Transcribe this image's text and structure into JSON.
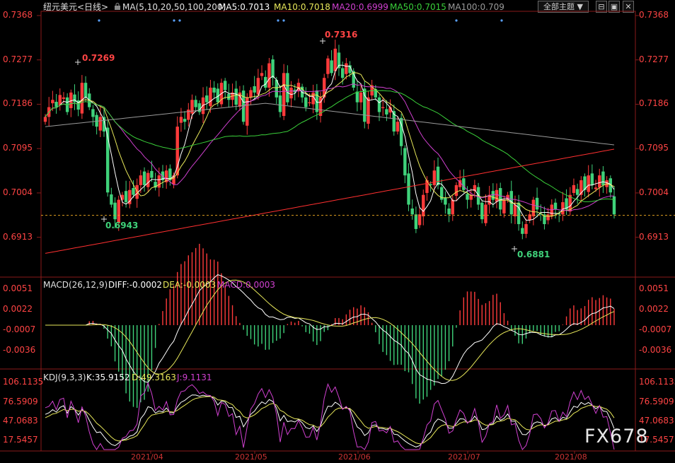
{
  "header": {
    "symbol_label": "纽元美元<日线>",
    "ma_title": "MA(5,10,20,50,100,200)",
    "ma5": "MA5:0.7013",
    "ma10": "MA10:0.7018",
    "ma20": "MA20:0.6999",
    "ma50": "MA50:0.7015",
    "ma100": "MA100:0.709",
    "theme_button": "全部主题",
    "window_icons": [
      "restore-icon",
      "window-icon",
      "close-icon"
    ]
  },
  "price_axis": {
    "ticks": [
      "0.7368",
      "0.7277",
      "0.7186",
      "0.7095",
      "0.7004",
      "0.6913"
    ]
  },
  "annotations": {
    "high1": "0.7269",
    "low1": "0.6943",
    "high2": "0.7316",
    "low2": "0.6881"
  },
  "macd": {
    "title": "MACD(26,12,9)",
    "diff": "DIFF:-0.0002",
    "dea": "DEA:-0.0003",
    "macd": "MACD:0.0003",
    "ticks": [
      "0.0051",
      "0.0022",
      "-0.0007",
      "-0.0036"
    ]
  },
  "kdj": {
    "title": "KDJ(9,3,3)",
    "k": "K:35.9152",
    "d": "D:49.3163",
    "j": "J:9.1131",
    "ticks": [
      "106.1135",
      "76.5909",
      "47.0683",
      "17.5457"
    ]
  },
  "date_axis": [
    "2021/04",
    "2021/05",
    "2021/06",
    "2021/07",
    "2021/08"
  ],
  "watermark": "FX678",
  "colors": {
    "background": "#000000",
    "up": "#ff3b3b",
    "down": "#3fd27a",
    "axis_text": "#ff4444",
    "ma5": "#ffffff",
    "ma10": "#e8e85a",
    "ma20": "#d040d0",
    "ma50": "#3ad03a",
    "ma100": "#9a9a9a",
    "ma200": "#ff3030"
  },
  "chart_data": {
    "type": "candlestick",
    "series_names": [
      "MA5",
      "MA10",
      "MA20",
      "MA50",
      "MA100",
      "MA200"
    ],
    "ylim": [
      0.684,
      0.7368
    ],
    "current_price_line": 0.6958,
    "x_dates": [
      "2021/04",
      "2021/05",
      "2021/06",
      "2021/07",
      "2021/08"
    ],
    "close": [
      0.716,
      0.718,
      0.7195,
      0.718,
      0.7205,
      0.72,
      0.717,
      0.721,
      0.719,
      0.7175,
      0.723,
      0.72,
      0.718,
      0.716,
      0.714,
      0.716,
      0.713,
      0.7005,
      0.698,
      0.695,
      0.699,
      0.7,
      0.6985,
      0.701,
      0.7,
      0.702,
      0.704,
      0.702,
      0.7045,
      0.7035,
      0.7015,
      0.704,
      0.703,
      0.705,
      0.703,
      0.704,
      0.714,
      0.716,
      0.715,
      0.7175,
      0.7195,
      0.718,
      0.717,
      0.72,
      0.719,
      0.722,
      0.721,
      0.719,
      0.723,
      0.7215,
      0.7195,
      0.721,
      0.7185,
      0.721,
      0.715,
      0.72,
      0.7215,
      0.721,
      0.724,
      0.725,
      0.722,
      0.727,
      0.724,
      0.72,
      0.717,
      0.725,
      0.719,
      0.722,
      0.721,
      0.723,
      0.72,
      0.718,
      0.719,
      0.721,
      0.717,
      0.72,
      0.724,
      0.728,
      0.725,
      0.73,
      0.726,
      0.724,
      0.727,
      0.725,
      0.722,
      0.719,
      0.721,
      0.715,
      0.72,
      0.7225,
      0.72,
      0.717,
      0.718,
      0.7165,
      0.718,
      0.713,
      0.715,
      0.71,
      0.704,
      0.698,
      0.696,
      0.693,
      0.696,
      0.7,
      0.703,
      0.702,
      0.705,
      0.702,
      0.699,
      0.698,
      0.696,
      0.699,
      0.702,
      0.703,
      0.701,
      0.699,
      0.7,
      0.702,
      0.698,
      0.695,
      0.698,
      0.7,
      0.699,
      0.701,
      0.697,
      0.699,
      0.7,
      0.696,
      0.698,
      0.694,
      0.692,
      0.694,
      0.696,
      0.699,
      0.697,
      0.696,
      0.694,
      0.696,
      0.698,
      0.697,
      0.696,
      0.6985,
      0.697,
      0.7,
      0.702,
      0.7,
      0.703,
      0.701,
      0.704,
      0.702,
      0.7015,
      0.704,
      0.702,
      0.703,
      0.7005,
      0.696
    ],
    "macd_hist_last": 0.0003,
    "kdj_last": {
      "K": 35.9152,
      "D": 49.3163,
      "J": 9.1131
    }
  }
}
